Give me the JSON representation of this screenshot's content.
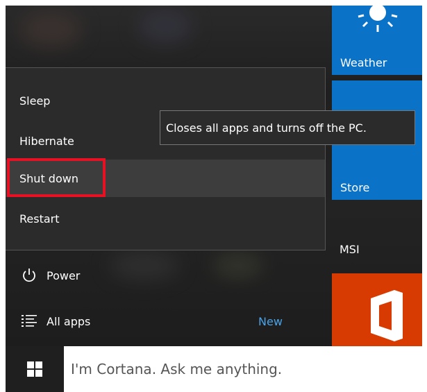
{
  "tiles": {
    "weather": {
      "label": "Weather"
    },
    "store": {
      "label": "Store"
    },
    "msi": {
      "label": "MSI"
    }
  },
  "power_menu": {
    "items": [
      {
        "label": "Sleep"
      },
      {
        "label": "Hibernate"
      },
      {
        "label": "Shut down"
      },
      {
        "label": "Restart"
      }
    ],
    "tooltip": "Closes all apps and turns off the PC."
  },
  "start_list": {
    "power_label": "Power",
    "all_apps_label": "All apps",
    "new_badge": "New"
  },
  "taskbar": {
    "search_text": "I'm Cortana. Ask me anything."
  },
  "icons": {
    "power": "power-icon",
    "all_apps": "all-apps-list-icon",
    "windows": "windows-logo-icon",
    "weather": "sun-icon",
    "office": "office-logo-icon"
  },
  "colors": {
    "tile_blue": "#0a72c7",
    "office_orange": "#d83b01",
    "highlight_red": "#e81123",
    "new_badge": "#4aa3e8"
  }
}
